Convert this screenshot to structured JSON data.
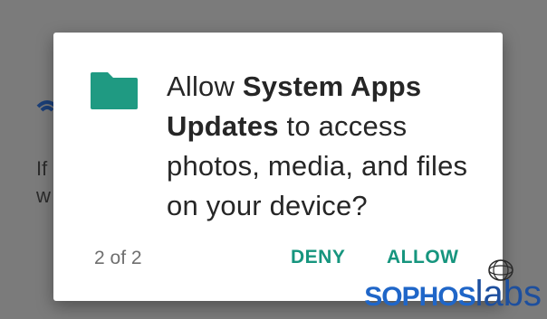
{
  "background": {
    "text_line_1": "If",
    "text_line_2": "w"
  },
  "dialog": {
    "icon": "folder-icon",
    "message_prefix": "Allow ",
    "app_name": "System Apps Updates",
    "message_suffix": " to access photos, media, and files on your device?",
    "page_counter": "2 of 2",
    "deny_label": "DENY",
    "allow_label": "ALLOW"
  },
  "watermark": {
    "brand": "SOPHOS",
    "suffix": "labs"
  },
  "colors": {
    "accent": "#16957e",
    "folder": "#1f9a82",
    "scrim": "#7b7b7b",
    "brand_blue": "#1f66c8"
  }
}
